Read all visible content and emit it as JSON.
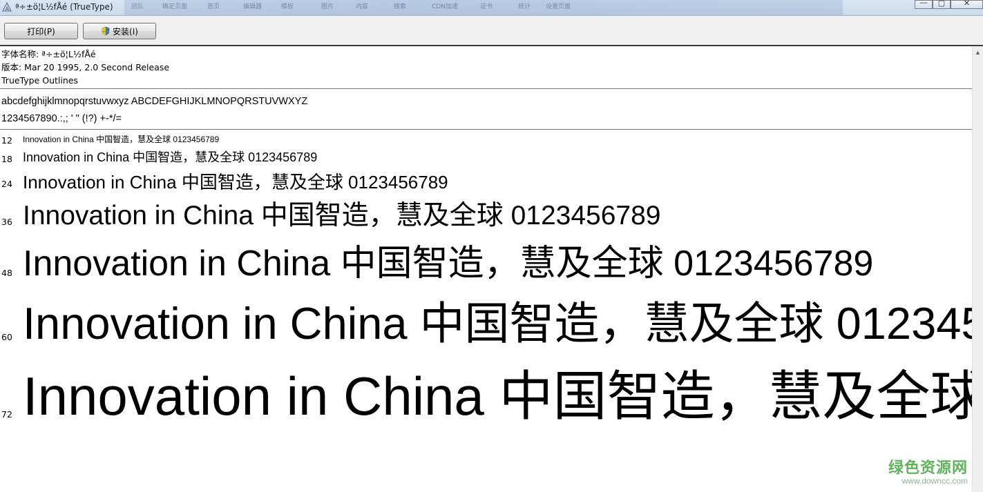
{
  "window": {
    "title": "ª÷±ö¦L½fÅé (TrueType)",
    "bg_tabs": [
      "团队",
      "确定页面",
      "首页",
      "编辑器",
      "模板",
      "图片",
      "内容",
      "搜索",
      "CDN加速",
      "证书",
      "统计",
      "设置页面"
    ],
    "controls": {
      "minimize": "—",
      "maximize": "▢",
      "close": "✕"
    }
  },
  "toolbar": {
    "print_label": "打印(P)",
    "install_label": "安装(I)"
  },
  "info": {
    "font_name": "字体名称: ª÷±ö¦L½fÅé",
    "version": "版本: Mar 20 1995, 2.0 Second Release",
    "outline": "TrueType Outlines"
  },
  "charset": {
    "line1": "abcdefghijklmnopqrstuvwxyz ABCDEFGHIJKLMNOPQRSTUVWXYZ",
    "line2": "1234567890.:,; ' \" (!?) +-*/="
  },
  "sample_text": "Innovation in China 中国智造，慧及全球 0123456789",
  "samples": [
    {
      "size": "12"
    },
    {
      "size": "18"
    },
    {
      "size": "24"
    },
    {
      "size": "36"
    },
    {
      "size": "48"
    },
    {
      "size": "60"
    },
    {
      "size": "72"
    }
  ],
  "watermark": {
    "main": "绿色资源网",
    "sub": "www.downcc.com"
  },
  "colors": {
    "watermark_green": "#5fb35a",
    "titlebar": "#c9d9ec"
  }
}
